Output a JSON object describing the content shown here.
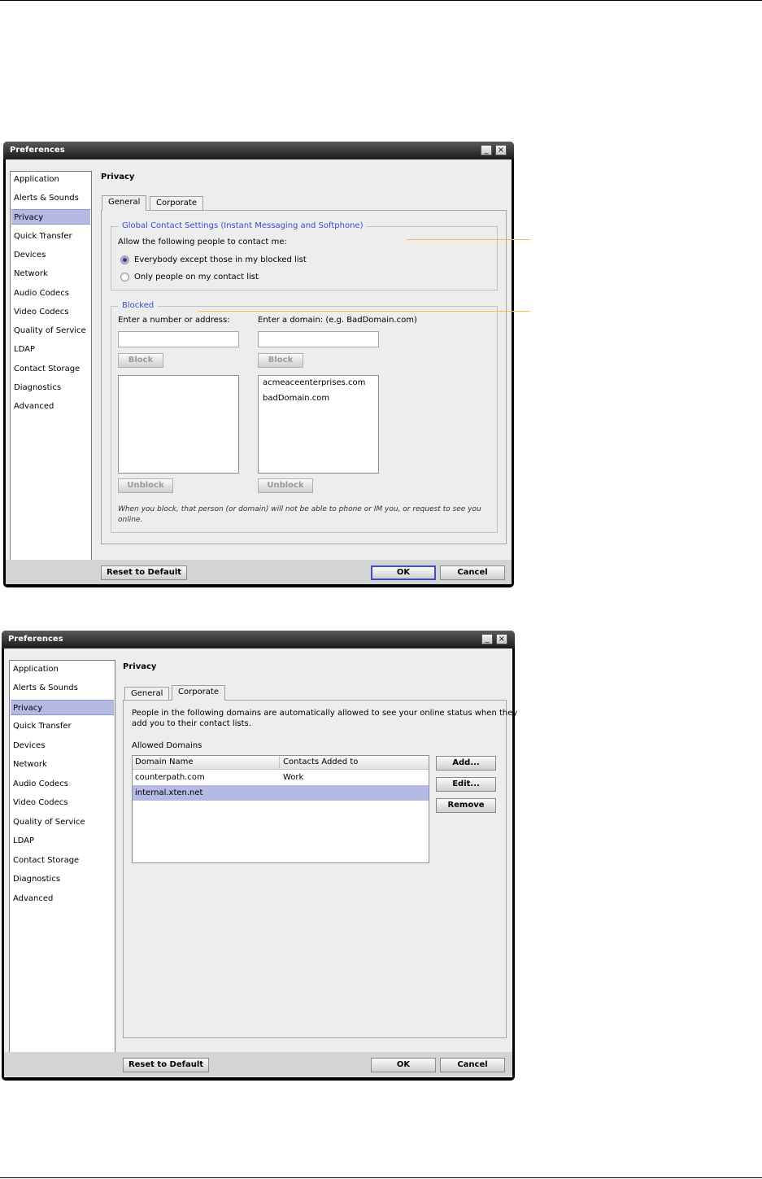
{
  "window1": {
    "title": "Preferences",
    "minimize_glyph": "_",
    "close_glyph": "×",
    "sidebar": [
      "Application",
      "Alerts & Sounds",
      "Privacy",
      "Quick Transfer",
      "Devices",
      "Network",
      "Audio Codecs",
      "Video Codecs",
      "Quality of Service",
      "LDAP",
      "Contact Storage",
      "Diagnostics",
      "Advanced"
    ],
    "selected_item": "Privacy",
    "heading": "Privacy",
    "tabs": [
      "General",
      "Corporate"
    ],
    "active_tab": "General",
    "global_group": {
      "legend": "Global Contact Settings (Instant Messaging and Softphone)",
      "prompt": "Allow the following people to contact me:",
      "option1": "Everybody except those in my blocked list",
      "option2": "Only people on my contact list",
      "selected_option": "option1"
    },
    "blocked_group": {
      "legend": "Blocked",
      "left_label": "Enter a number or address:",
      "left_input_value": "",
      "right_label": "Enter a domain: (e.g. BadDomain.com)",
      "right_input_value": "",
      "block_label": "Block",
      "unblock_label": "Unblock",
      "left_list": [],
      "right_list": [
        "acmeaceenterprises.com",
        "badDomain.com"
      ],
      "note_line1": "When you block, that person (or domain) will not be able to phone or IM you, or request to see you",
      "note_line2": "online."
    },
    "reset_label": "Reset to Default",
    "ok_label": "OK",
    "cancel_label": "Cancel"
  },
  "window2": {
    "title": "Preferences",
    "minimize_glyph": "_",
    "close_glyph": "×",
    "sidebar": [
      "Application",
      "Alerts & Sounds",
      "Privacy",
      "Quick Transfer",
      "Devices",
      "Network",
      "Audio Codecs",
      "Video Codecs",
      "Quality of Service",
      "LDAP",
      "Contact Storage",
      "Diagnostics",
      "Advanced"
    ],
    "selected_item": "Privacy",
    "heading": "Privacy",
    "tabs": [
      "General",
      "Corporate"
    ],
    "active_tab": "Corporate",
    "description_line1": "People in the following domains are automatically allowed to see your online status when they",
    "description_line2": "add you to their contact lists.",
    "allowed_label": "Allowed Domains",
    "columns": [
      "Domain Name",
      "Contacts Added to"
    ],
    "rows": [
      {
        "domain": "counterpath.com",
        "group": "Work",
        "selected": false
      },
      {
        "domain": "internal.xten.net",
        "group": "",
        "selected": true
      }
    ],
    "add_label": "Add...",
    "edit_label": "Edit...",
    "remove_label": "Remove",
    "reset_label": "Reset to Default",
    "ok_label": "OK",
    "cancel_label": "Cancel"
  },
  "colors": {
    "selection": "#b5b9e6",
    "legend_text": "#3b4bd0",
    "callout": "#f0c24a",
    "titlebar": "#1a1a1a"
  }
}
